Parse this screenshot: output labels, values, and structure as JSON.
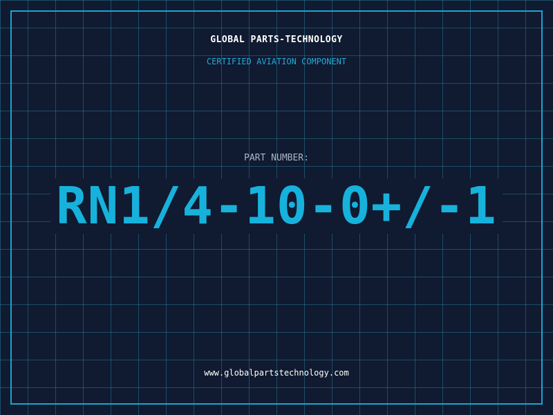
{
  "header": {
    "company": "GLOBAL PARTS-TECHNOLOGY",
    "subtitle": "CERTIFIED AVIATION COMPONENT"
  },
  "part": {
    "label": "PART NUMBER:",
    "number": "RN1/4-10-0+/-1"
  },
  "footer": {
    "website": "www.globalpartstechnology.com"
  },
  "colors": {
    "background": "#101a30",
    "grid": "#26789a",
    "frame": "#1aa6d0",
    "accent": "#17b2dc",
    "label": "#a9b6c6",
    "text": "#ffffff"
  }
}
